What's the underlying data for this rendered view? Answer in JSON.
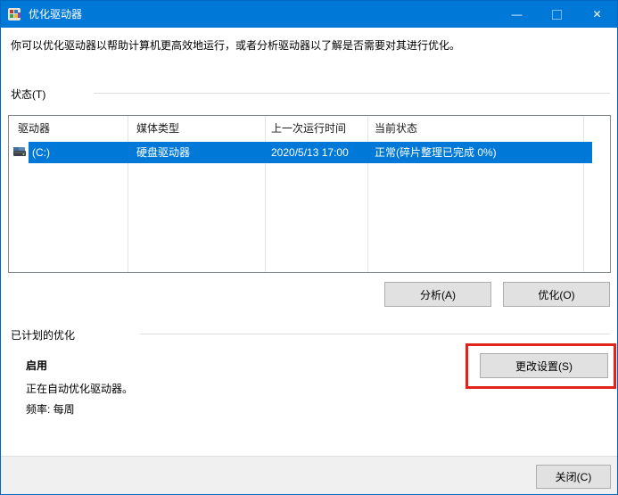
{
  "window": {
    "title": "优化驱动器",
    "controls": {
      "minimize_glyph": "—",
      "close_glyph": "✕"
    }
  },
  "description": "你可以优化驱动器以帮助计算机更高效地运行，或者分析驱动器以了解是否需要对其进行优化。",
  "status_section": {
    "label": "状态(T)",
    "table": {
      "columns": [
        "驱动器",
        "媒体类型",
        "上一次运行时间",
        "当前状态"
      ],
      "rows": [
        {
          "drive": "(C:)",
          "media_type": "硬盘驱动器",
          "last_run": "2020/5/13 17:00",
          "current_status": "正常(碎片整理已完成 0%)",
          "selected": true
        }
      ]
    },
    "analyze_button": "分析(A)",
    "optimize_button": "优化(O)"
  },
  "scheduled_section": {
    "label": "已计划的优化",
    "status": "启用",
    "description": "正在自动优化驱动器。",
    "frequency": "频率: 每周",
    "change_settings_button": "更改设置(S)"
  },
  "footer": {
    "close_button": "关闭(C)"
  },
  "colors": {
    "accent": "#0078d7",
    "selection": "#0078d7",
    "annotation_red": "#e0241b",
    "button_bg": "#e1e1e1",
    "button_border": "#adadad",
    "table_border": "#828790",
    "footer_bg": "#f0f0f0"
  }
}
